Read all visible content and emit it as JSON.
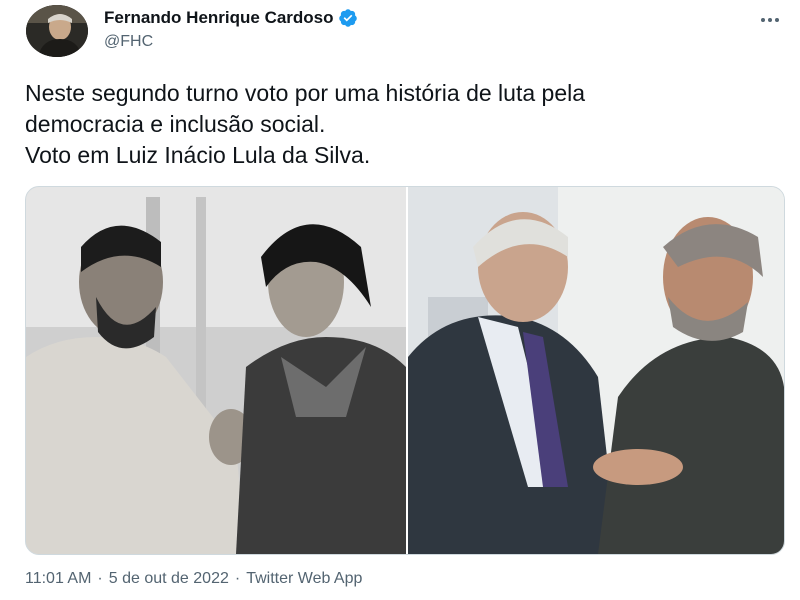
{
  "author": {
    "display_name": "Fernando Henrique Cardoso",
    "handle": "@FHC",
    "verified": true,
    "avatar_icon": "profile-photo"
  },
  "tweet": {
    "lines": [
      "Neste segundo turno voto por uma história de luta pela",
      "democracia e inclusão social.",
      "Voto em Luiz Inácio Lula da Silva."
    ]
  },
  "media": {
    "photos": [
      {
        "style": "black-and-white"
      },
      {
        "style": "color"
      }
    ]
  },
  "meta": {
    "time": "11:01 AM",
    "separator": "·",
    "date": "5 de out de 2022",
    "source": "Twitter Web App"
  },
  "colors": {
    "text": "#0f1419",
    "secondary": "#536471",
    "verified_badge": "#1d9bf0",
    "border": "#cfd9de"
  }
}
